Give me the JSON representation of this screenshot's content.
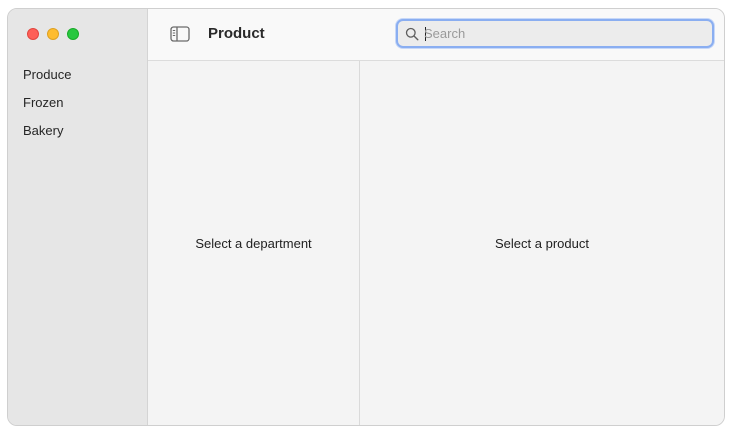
{
  "window": {
    "controls": {
      "close": "#fe5f57",
      "minimize": "#febc2e",
      "zoom": "#28c840"
    }
  },
  "sidebar": {
    "items": [
      {
        "label": "Produce"
      },
      {
        "label": "Frozen"
      },
      {
        "label": "Bakery"
      }
    ]
  },
  "toolbar": {
    "sidebar_toggle_icon": "sidebar-left-icon",
    "title": "Product",
    "search": {
      "placeholder": "Search",
      "value": "",
      "icon": "magnifying-glass-icon",
      "focused": true,
      "focus_color": "#8aaef1"
    }
  },
  "panes": {
    "department_placeholder": "Select a department",
    "product_placeholder": "Select a product"
  }
}
